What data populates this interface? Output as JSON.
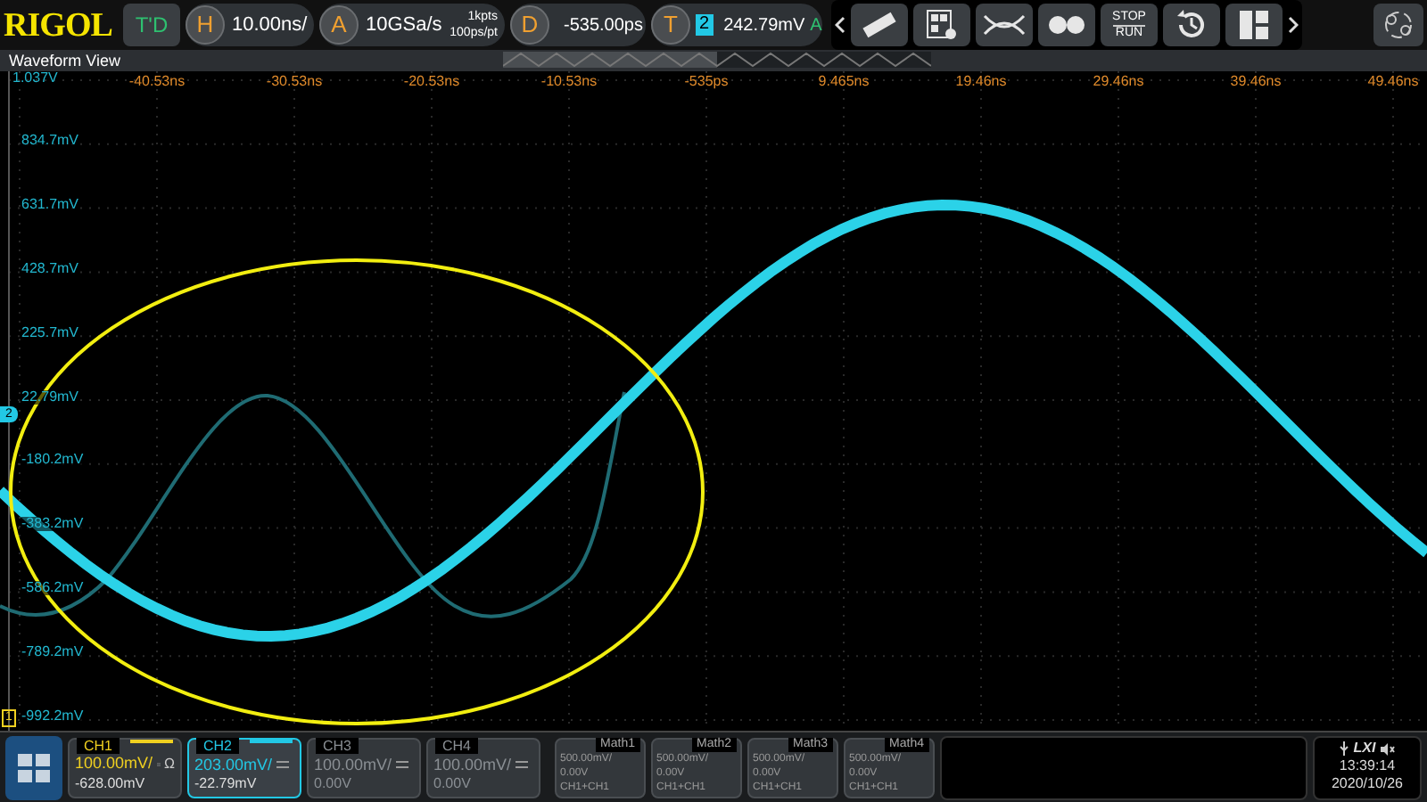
{
  "logo": "RIGOL",
  "run_state": "T'D",
  "horizontal": {
    "badge": "H",
    "scale": "10.00ns/"
  },
  "acquire": {
    "badge": "A",
    "rate": "10GSa/s",
    "depth": "1kpts",
    "resolution": "100ps/pt"
  },
  "delay": {
    "badge": "D",
    "value": "-535.00ps"
  },
  "trigger": {
    "badge": "T",
    "source": "2",
    "level": "242.79mV",
    "mode": "A"
  },
  "toolbar": [
    {
      "kind": "ruler"
    },
    {
      "kind": "panel"
    },
    {
      "kind": "cross"
    },
    {
      "kind": "dots"
    },
    {
      "kind": "stoprun",
      "top": "STOP",
      "bottom": "RUN"
    },
    {
      "kind": "history"
    },
    {
      "kind": "layout"
    }
  ],
  "waveform_view": {
    "title": "Waveform View",
    "top_label": "1.037V",
    "y_labels": [
      "834.7mV",
      "631.7mV",
      "428.7mV",
      "225.7mV",
      "22.79mV",
      "-180.2mV",
      "-383.2mV",
      "-586.2mV",
      "-789.2mV",
      "-992.2mV"
    ],
    "x_labels": [
      "-40.53ns",
      "-30.53ns",
      "-20.53ns",
      "-10.53ns",
      "-535ps",
      "9.465ns",
      "19.46ns",
      "29.46ns",
      "39.46ns",
      "49.46ns"
    ],
    "channel_marker": "2",
    "ground_marker": "1"
  },
  "channels": [
    {
      "name": "CH1",
      "scale": "100.00mV/",
      "offset": "-628.00mV",
      "impedance": "Ω",
      "on": true,
      "selected": false,
      "color": "#f0d020"
    },
    {
      "name": "CH2",
      "scale": "203.00mV/",
      "offset": "-22.79mV",
      "on": true,
      "selected": true,
      "color": "#22c8e5"
    },
    {
      "name": "CH3",
      "scale": "100.00mV/",
      "offset": "0.00V",
      "on": false,
      "selected": false
    },
    {
      "name": "CH4",
      "scale": "100.00mV/",
      "offset": "0.00V",
      "on": false,
      "selected": false
    }
  ],
  "math": [
    {
      "name": "Math1",
      "scale": "500.00mV/",
      "offset": "0.00V",
      "source": "CH1+CH1"
    },
    {
      "name": "Math2",
      "scale": "500.00mV/",
      "offset": "0.00V",
      "source": "CH1+CH1"
    },
    {
      "name": "Math3",
      "scale": "500.00mV/",
      "offset": "0.00V",
      "source": "CH1+CH1"
    },
    {
      "name": "Math4",
      "scale": "500.00mV/",
      "offset": "0.00V",
      "source": "CH1+CH1"
    }
  ],
  "status": {
    "lxi": "LXI",
    "time": "13:39:14",
    "date": "2020/10/26"
  }
}
